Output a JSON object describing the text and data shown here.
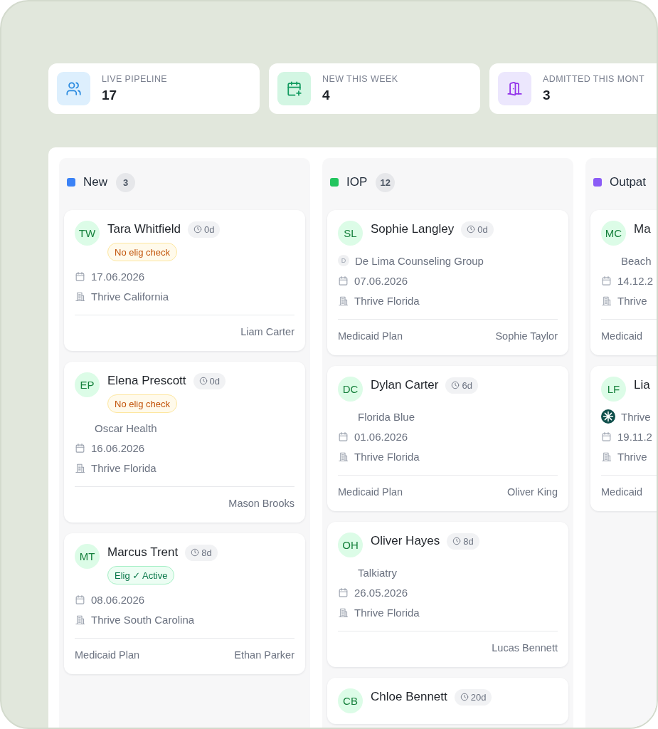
{
  "stats": [
    {
      "kind": "people",
      "label": "LIVE PIPELINE",
      "value": "17"
    },
    {
      "kind": "calendar-plus",
      "label": "NEW THIS WEEK",
      "value": "4"
    },
    {
      "kind": "door",
      "label": "ADMITTED THIS MONT",
      "value": "3"
    }
  ],
  "columns": [
    {
      "title": "New",
      "count": "3",
      "color": "#3b82f6",
      "cards": [
        {
          "initials": "TW",
          "name": "Tara Whitfield",
          "age": "0d",
          "badge": {
            "kind": "warning",
            "label": "No elig check"
          },
          "date": "17.06.2026",
          "location": "Thrive California",
          "owner": "Liam Carter"
        },
        {
          "initials": "EP",
          "name": "Elena Prescott",
          "age": "0d",
          "badge": {
            "kind": "warning",
            "label": "No elig check"
          },
          "payer": {
            "kind": "plain",
            "name": "Oscar Health"
          },
          "date": "16.06.2026",
          "location": "Thrive Florida",
          "owner": "Mason Brooks"
        },
        {
          "initials": "MT",
          "name": "Marcus Trent",
          "age": "8d",
          "badge": {
            "kind": "active",
            "label": "Elig ✓ Active"
          },
          "date": "08.06.2026",
          "location": "Thrive South Carolina",
          "plan": "Medicaid Plan",
          "owner": "Ethan Parker"
        }
      ]
    },
    {
      "title": "IOP",
      "count": "12",
      "color": "#22c55e",
      "cards": [
        {
          "initials": "SL",
          "name": "Sophie Langley",
          "age": "0d",
          "payer": {
            "kind": "initial",
            "initial": "D",
            "name": "De Lima Counseling Group"
          },
          "date": "07.06.2026",
          "location": "Thrive Florida",
          "plan": "Medicaid Plan",
          "owner": "Sophie Taylor"
        },
        {
          "initials": "DC",
          "name": "Dylan Carter",
          "age": "6d",
          "payer": {
            "kind": "plain",
            "name": "Florida Blue"
          },
          "date": "01.06.2026",
          "location": "Thrive Florida",
          "plan": "Medicaid Plan",
          "owner": "Oliver King"
        },
        {
          "initials": "OH",
          "name": "Oliver Hayes",
          "age": "8d",
          "payer": {
            "kind": "plain",
            "name": "Talkiatry"
          },
          "date": "26.05.2026",
          "location": "Thrive Florida",
          "owner": "Lucas Bennett"
        },
        {
          "initials": "CB",
          "name": "Chloe Bennett",
          "age": "20d"
        }
      ]
    },
    {
      "title": "Outpat",
      "color": "#8b5cf6",
      "cards": [
        {
          "initials": "MC",
          "name": "Ma",
          "payer": {
            "kind": "plain",
            "name": "Beach"
          },
          "date": "14.12.2",
          "location": "Thrive",
          "plan": "Medicaid"
        },
        {
          "initials": "LF",
          "name": "Lia",
          "payer": {
            "kind": "logo",
            "name": "Thrive"
          },
          "date": "19.11.2",
          "location": "Thrive",
          "plan": "Medicaid"
        }
      ]
    }
  ]
}
